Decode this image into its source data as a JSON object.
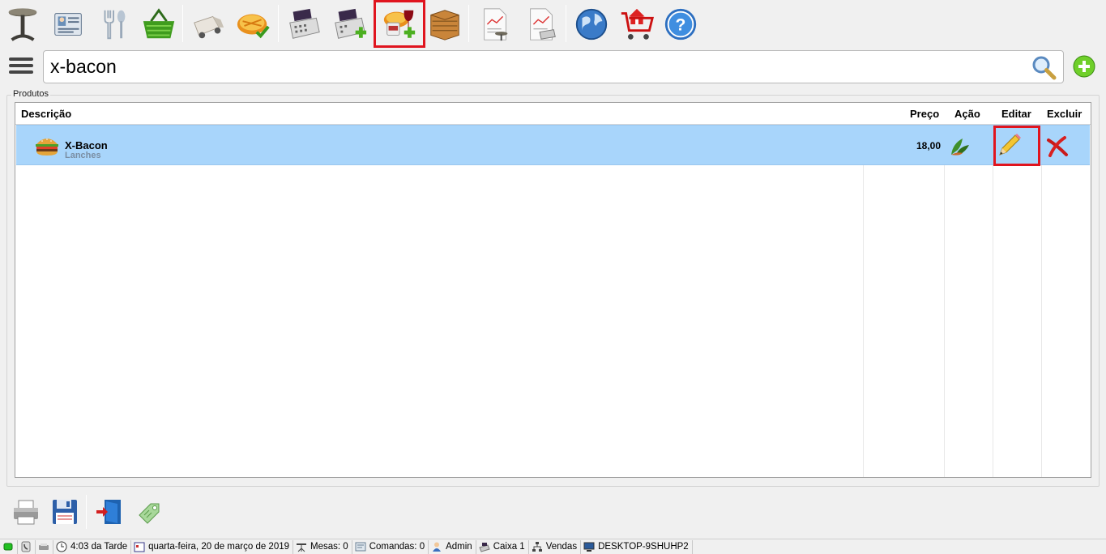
{
  "toolbar": {
    "buttons": [
      {
        "icon": "table-icon",
        "label": "Mesas"
      },
      {
        "icon": "card-icon",
        "label": "Clientes"
      },
      {
        "icon": "cutlery-icon",
        "label": "Cardápio"
      },
      {
        "icon": "basket-icon",
        "label": "Vendas"
      },
      {
        "icon": "delivery-truck-icon",
        "label": "Delivery"
      },
      {
        "icon": "pie-check-icon",
        "label": "Pedidos"
      },
      {
        "icon": "cash-register-icon",
        "label": "Caixa"
      },
      {
        "icon": "cash-register-add-icon",
        "label": "Caixa adicionar"
      },
      {
        "icon": "food-drink-add-icon",
        "label": "Produtos"
      },
      {
        "icon": "crate-icon",
        "label": "Estoque"
      },
      {
        "icon": "report-table-icon",
        "label": "Relatório mesas"
      },
      {
        "icon": "report-register-icon",
        "label": "Relatório caixa"
      },
      {
        "icon": "globe-icon",
        "label": "Internet"
      },
      {
        "icon": "shop-cart-icon",
        "label": "Loja"
      },
      {
        "icon": "help-icon",
        "label": "Ajuda"
      }
    ]
  },
  "search": {
    "value": "x-bacon"
  },
  "products": {
    "group_label": "Produtos",
    "columns": {
      "description": "Descrição",
      "price": "Preço",
      "action": "Ação",
      "edit": "Editar",
      "delete": "Excluir"
    },
    "rows": [
      {
        "name": "X-Bacon",
        "category": "Lanches",
        "price": "18,00"
      }
    ]
  },
  "status_bar": {
    "time": "4:03 da Tarde",
    "date": "quarta-feira, 20 de março de 2019",
    "tables": "Mesas: 0",
    "orders": "Comandas: 0",
    "user": "Admin",
    "register": "Caixa 1",
    "mode": "Vendas",
    "computer": "DESKTOP-9SHUHP2"
  },
  "colors": {
    "highlight": "#e0141e",
    "selected_row": "#a8d5fb",
    "background": "#f0f0f0"
  }
}
